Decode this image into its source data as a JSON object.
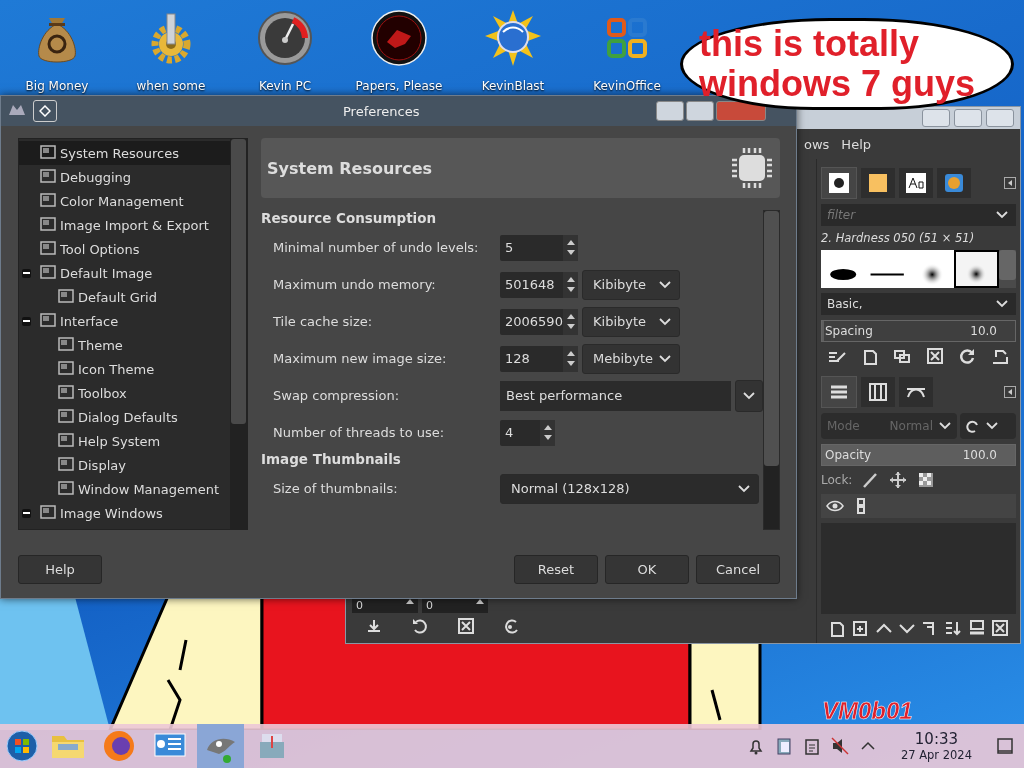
{
  "desktop": {
    "icons": [
      {
        "kind": "money-bag",
        "label": "Big Money"
      },
      {
        "kind": "gear",
        "label": "when some"
      },
      {
        "kind": "gauge",
        "label": "Kevin PC"
      },
      {
        "kind": "seal",
        "label": "Papers, Please"
      },
      {
        "kind": "globe",
        "label": "KevinBlast"
      },
      {
        "kind": "office",
        "label": "KevinOffice"
      }
    ],
    "speech_bubble": {
      "lines": [
        "this is totally",
        "windows 7 guys"
      ]
    },
    "desktop_text": "VM0b01"
  },
  "gimp_window": {
    "menu": [
      "ows",
      "Help"
    ],
    "brush_tabs": [
      {
        "kind": "brush",
        "selected": true
      },
      {
        "kind": "pattern",
        "selected": false
      },
      {
        "kind": "font",
        "selected": false
      },
      {
        "kind": "gradient",
        "selected": false
      }
    ],
    "filter_placeholder": "filter",
    "brush_name": "2. Hardness 050 (51 × 51)",
    "brushes": [
      {
        "kind": "ellipse",
        "selected": false
      },
      {
        "kind": "line",
        "selected": false
      },
      {
        "kind": "soft",
        "selected": false
      },
      {
        "kind": "soft",
        "selected": true
      }
    ],
    "tag": "Basic,",
    "spacing": {
      "label": "Spacing",
      "value": "10.0",
      "level": 0.01
    },
    "layer_tabs": [
      {
        "kind": "layers",
        "selected": true
      },
      {
        "kind": "channels",
        "selected": false
      },
      {
        "kind": "paths",
        "selected": false
      }
    ],
    "mode": {
      "label": "Mode",
      "value": "Normal"
    },
    "opacity": {
      "label": "Opacity",
      "value": "100.0",
      "level": 1
    },
    "lock_label": "Lock:",
    "canvas_fields": [
      "0",
      "0"
    ]
  },
  "preferences": {
    "title": "Preferences",
    "tree": [
      {
        "label": "System Resources",
        "selected": true
      },
      {
        "label": "Debugging",
        "selected": false
      },
      {
        "label": "Color Management",
        "selected": false
      },
      {
        "label": "Image Import & Export",
        "selected": false
      },
      {
        "label": "Tool Options",
        "selected": false
      },
      {
        "label": "Default Image",
        "selected": false,
        "expanded": true,
        "children": [
          {
            "label": "Default Grid",
            "selected": false
          }
        ]
      },
      {
        "label": "Interface",
        "selected": false,
        "expanded": true,
        "children": [
          {
            "label": "Theme",
            "selected": false
          },
          {
            "label": "Icon Theme",
            "selected": false
          },
          {
            "label": "Toolbox",
            "selected": false
          },
          {
            "label": "Dialog Defaults",
            "selected": false
          },
          {
            "label": "Help System",
            "selected": false
          },
          {
            "label": "Display",
            "selected": false
          },
          {
            "label": "Window Management",
            "selected": false
          }
        ]
      },
      {
        "label": "Image Windows",
        "selected": false,
        "expanded": true
      }
    ],
    "page_title": "System Resources",
    "sections": [
      {
        "title": "Resource Consumption",
        "rows": [
          {
            "kind": "spin",
            "label": "Minimal number of undo levels:",
            "value": "5"
          },
          {
            "kind": "spin-unit",
            "label": "Maximum undo memory:",
            "value": "501648",
            "unit": "Kibibyte"
          },
          {
            "kind": "spin-unit",
            "label": "Tile cache size:",
            "value": "2006590",
            "unit": "Kibibyte"
          },
          {
            "kind": "spin-unit",
            "label": "Maximum new image size:",
            "value": "128",
            "unit": "Mebibyte"
          },
          {
            "kind": "combo-button",
            "label": "Swap compression:",
            "value": "Best performance"
          },
          {
            "kind": "spin-small",
            "label": "Number of threads to use:",
            "value": "4"
          }
        ]
      },
      {
        "title": "Image Thumbnails",
        "rows": [
          {
            "kind": "combo",
            "label": "Size of thumbnails:",
            "value": "Normal (128x128)"
          }
        ]
      }
    ],
    "buttons": [
      "Help",
      "Reset",
      "OK",
      "Cancel"
    ]
  },
  "taskbar": {
    "apps": [
      {
        "kind": "folder",
        "active": false
      },
      {
        "kind": "firefox",
        "active": false
      },
      {
        "kind": "control-panel",
        "active": false
      },
      {
        "kind": "gimp",
        "active": true
      },
      {
        "kind": "installer",
        "active": false
      }
    ],
    "time": "10:33",
    "date": "27 Apr 2024"
  }
}
